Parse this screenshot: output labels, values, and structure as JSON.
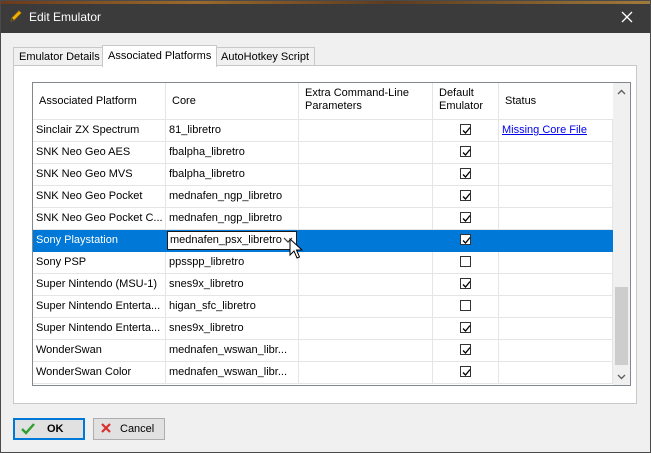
{
  "window": {
    "title": "Edit Emulator",
    "close_icon": "close-icon"
  },
  "tabs": [
    {
      "label": "Emulator Details"
    },
    {
      "label": "Associated Platforms"
    },
    {
      "label": "AutoHotkey Script"
    }
  ],
  "grid": {
    "columns": [
      "Associated Platform",
      "Core",
      "Extra Command-Line Parameters",
      "Default Emulator",
      "Status"
    ],
    "rows": [
      {
        "platform": "Sinclair ZX Spectrum",
        "core": "81_libretro",
        "params": "",
        "default": true,
        "status": "Missing Core File"
      },
      {
        "platform": "SNK Neo Geo AES",
        "core": "fbalpha_libretro",
        "params": "",
        "default": true,
        "status": ""
      },
      {
        "platform": "SNK Neo Geo MVS",
        "core": "fbalpha_libretro",
        "params": "",
        "default": true,
        "status": ""
      },
      {
        "platform": "SNK Neo Geo Pocket",
        "core": "mednafen_ngp_libretro",
        "params": "",
        "default": true,
        "status": ""
      },
      {
        "platform": "SNK Neo Geo Pocket C...",
        "core": "mednafen_ngp_libretro",
        "params": "",
        "default": true,
        "status": ""
      },
      {
        "platform": "Sony Playstation",
        "core": "mednafen_psx_libretro",
        "params": "",
        "default": true,
        "status": "",
        "selected": true
      },
      {
        "platform": "Sony PSP",
        "core": "ppsspp_libretro",
        "params": "",
        "default": false,
        "status": ""
      },
      {
        "platform": "Super Nintendo (MSU-1)",
        "core": "snes9x_libretro",
        "params": "",
        "default": true,
        "status": ""
      },
      {
        "platform": "Super Nintendo Enterta...",
        "core": "higan_sfc_libretro",
        "params": "",
        "default": false,
        "status": ""
      },
      {
        "platform": "Super Nintendo Enterta...",
        "core": "snes9x_libretro",
        "params": "",
        "default": true,
        "status": ""
      },
      {
        "platform": "WonderSwan",
        "core": "mednafen_wswan_libr...",
        "params": "",
        "default": true,
        "status": ""
      },
      {
        "platform": "WonderSwan Color",
        "core": "mednafen_wswan_libr...",
        "params": "",
        "default": true,
        "status": ""
      }
    ]
  },
  "buttons": {
    "ok": "OK",
    "cancel": "Cancel"
  },
  "colors": {
    "selection": "#0078d7",
    "titlebar": "#3b3b3b",
    "link": "#0000ee"
  }
}
